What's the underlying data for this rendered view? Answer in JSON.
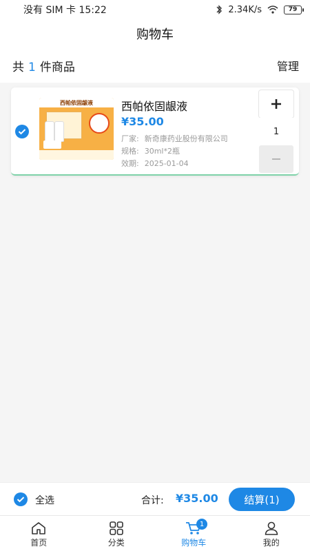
{
  "status_bar": {
    "carrier_time": "没有 SIM 卡 15:22",
    "net_speed": "2.34K/s",
    "battery": "79"
  },
  "page": {
    "title": "购物车"
  },
  "summary": {
    "prefix": "共",
    "count": "1",
    "suffix": "件商品",
    "manage_label": "管理"
  },
  "cart_items": [
    {
      "name": "西帕依固龈液",
      "price": "¥35.00",
      "manufacturer_label": "厂家:",
      "manufacturer": "新奇康药业股份有限公司",
      "spec_label": "规格:",
      "spec": "30ml*2瓶",
      "expiry_label": "效期:",
      "expiry": "2025-01-04",
      "quantity": "1",
      "selected": true,
      "image_text": "西帕依固龈液"
    }
  ],
  "footer": {
    "select_all_label": "全选",
    "total_label": "合计:",
    "total_value": "¥35.00",
    "checkout_label": "结算(1)"
  },
  "tabs": [
    {
      "label": "首页",
      "icon": "home-icon"
    },
    {
      "label": "分类",
      "icon": "grid-icon"
    },
    {
      "label": "购物车",
      "icon": "cart-icon",
      "badge": "1",
      "active": true
    },
    {
      "label": "我的",
      "icon": "user-icon"
    }
  ],
  "colors": {
    "accent": "#1e88e5",
    "muted": "#9a9a9a"
  }
}
